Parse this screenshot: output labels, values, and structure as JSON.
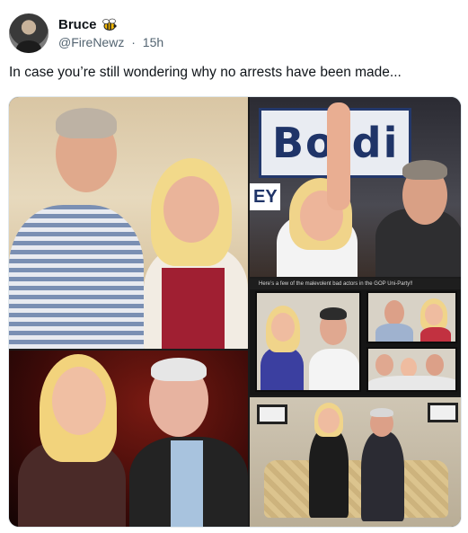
{
  "post": {
    "author": {
      "display_name": "Bruce",
      "badge_icon": "bee-icon",
      "handle": "@FireNewz",
      "separator": "·",
      "time_ago": "15h"
    },
    "text": "In case you’re still wondering why no arrests have been made...",
    "media": {
      "panels": [
        {
          "id": "photo-1",
          "description_icon": "photo"
        },
        {
          "id": "photo-2",
          "sign_text": "Bo di",
          "sign_sub": "EY"
        },
        {
          "id": "photo-3"
        },
        {
          "id": "photo-4",
          "caption": "Here’s a few of the malevolent bad actors in the GOP Uni-Party!!"
        },
        {
          "id": "photo-5"
        }
      ]
    }
  }
}
